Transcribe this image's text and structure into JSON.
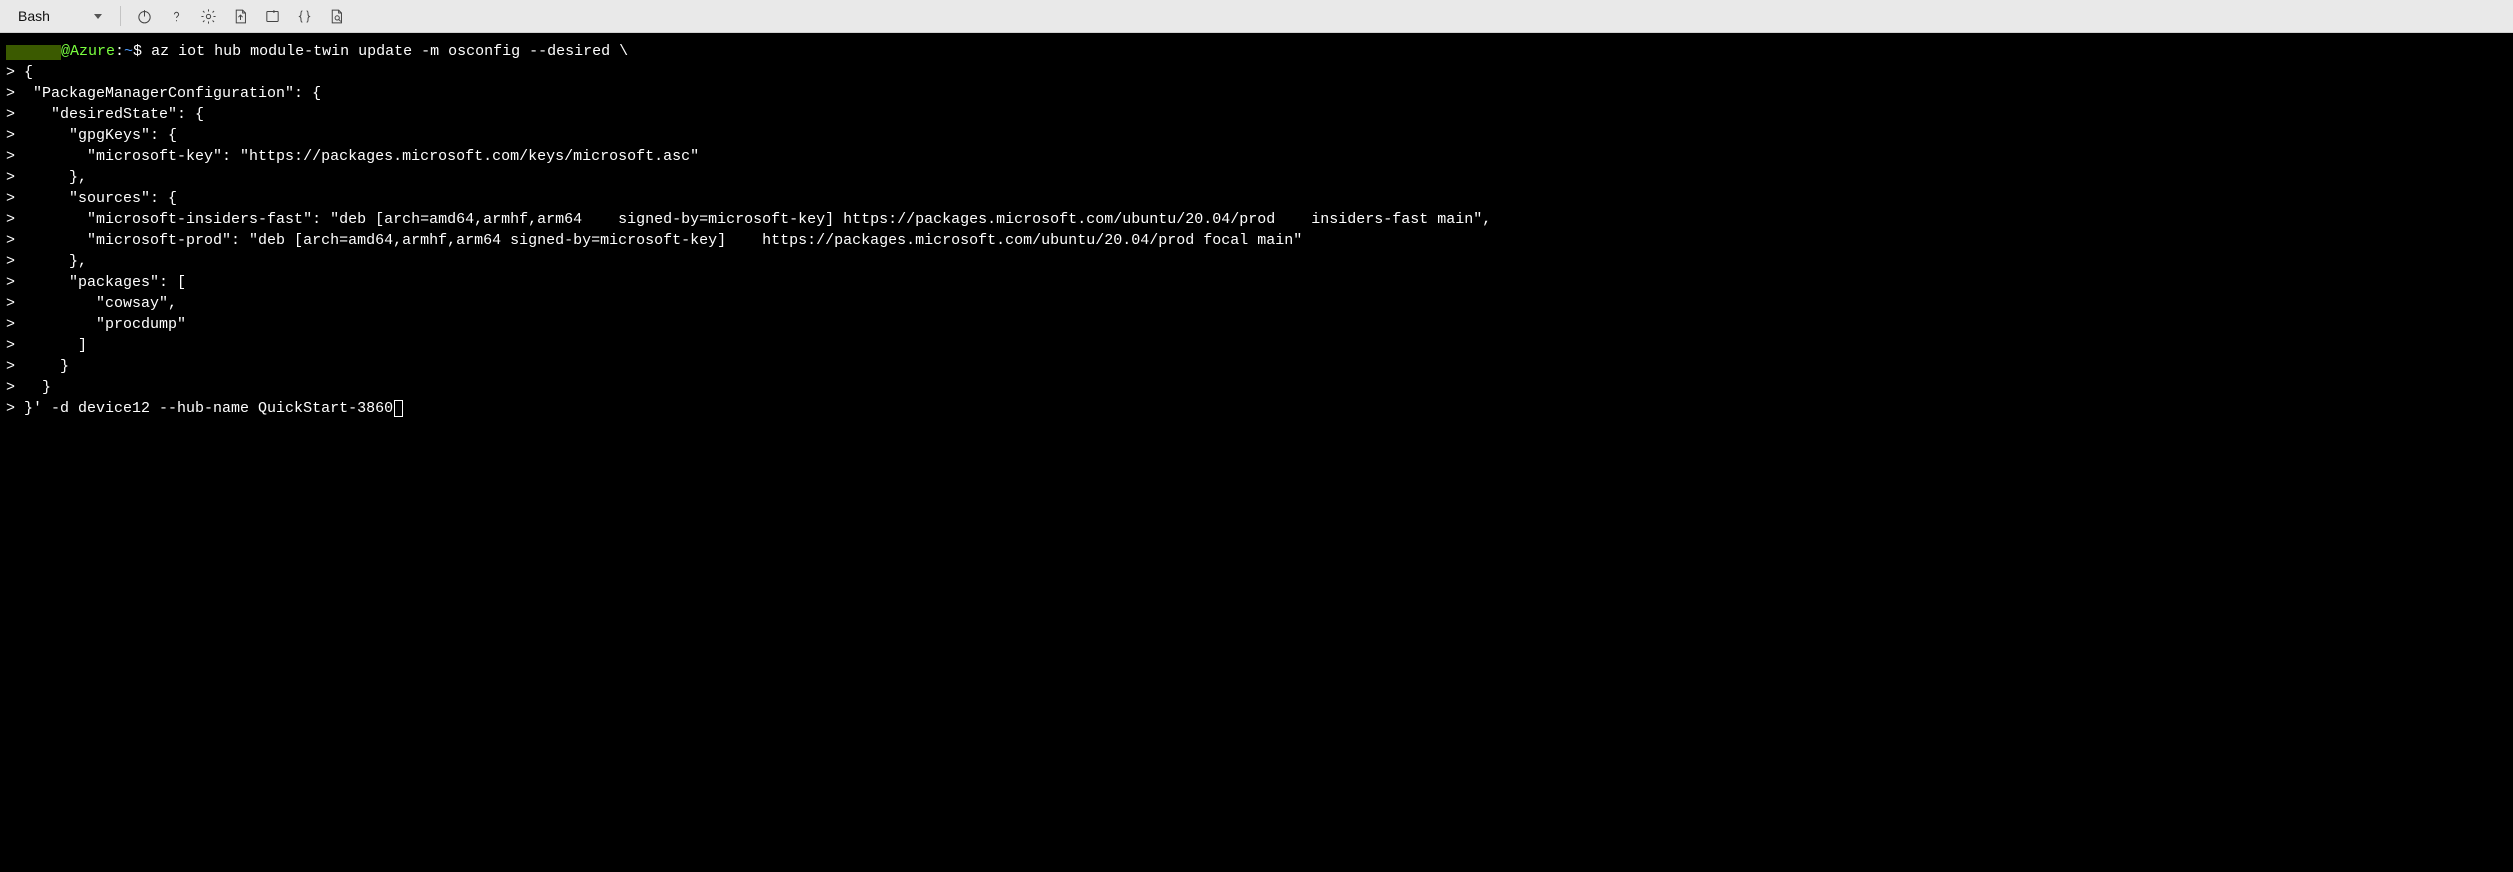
{
  "toolbar": {
    "shell_label": "Bash"
  },
  "prompt": {
    "at_host": "@Azure",
    "colon": ":",
    "path": "~",
    "dollar": "$"
  },
  "cmd": "az iot hub module-twin update -m osconfig --desired \\",
  "lines": [
    " {",
    "  \"PackageManagerConfiguration\": {",
    "    \"desiredState\": {",
    "      \"gpgKeys\": {",
    "        \"microsoft-key\": \"https://packages.microsoft.com/keys/microsoft.asc\"",
    "      },",
    "      \"sources\": {",
    "        \"microsoft-insiders-fast\": \"deb [arch=amd64,armhf,arm64    signed-by=microsoft-key] https://packages.microsoft.com/ubuntu/20.04/prod    insiders-fast main\",",
    "        \"microsoft-prod\": \"deb [arch=amd64,armhf,arm64 signed-by=microsoft-key]    https://packages.microsoft.com/ubuntu/20.04/prod focal main\"",
    "      },",
    "      \"packages\": [",
    "         \"cowsay\",",
    "         \"procdump\"",
    "       ]",
    "     }",
    "   }",
    " }' -d device12 --hub-name QuickStart-3860"
  ],
  "cont_marker": ">"
}
